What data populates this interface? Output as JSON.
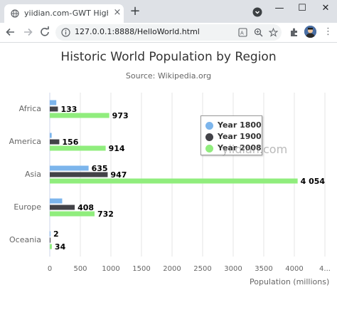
{
  "browser": {
    "tab_title": "yiidian.com-GWT Highcharts",
    "tab_close": "×",
    "new_tab": "+",
    "url": "127.0.0.1:8888/HelloWorld.html",
    "minimize": "—",
    "maximize": "☐",
    "close": "✕",
    "menu": "⋮",
    "icons": [
      "globe-icon",
      "back-icon",
      "forward-icon",
      "reload-icon",
      "info-icon",
      "translate-icon",
      "zoom-icon",
      "star-icon",
      "extensions-icon",
      "profile-avatar",
      "tab-search-icon"
    ]
  },
  "watermark": "yiidian.com",
  "chart_data": {
    "type": "bar",
    "orientation": "horizontal",
    "title": "Historic World Population by Region",
    "subtitle": "Source: Wikipedia.org",
    "xlabel": "",
    "ylabel": "Population (millions)",
    "categories": [
      "Africa",
      "America",
      "Asia",
      "Europe",
      "Oceania"
    ],
    "series": [
      {
        "name": "Year 1800",
        "color": "#7cb5ec",
        "values": [
          107,
          31,
          635,
          203,
          2
        ]
      },
      {
        "name": "Year 1900",
        "color": "#434348",
        "values": [
          133,
          156,
          947,
          408,
          6
        ]
      },
      {
        "name": "Year 2008",
        "color": "#90ed7d",
        "values": [
          973,
          914,
          4054,
          732,
          34
        ]
      }
    ],
    "data_labels": [
      [
        "",
        "133",
        "973"
      ],
      [
        "",
        "156",
        "914"
      ],
      [
        "635",
        "947",
        "4 054"
      ],
      [
        "",
        "408",
        "732"
      ],
      [
        "2",
        "",
        "34"
      ]
    ],
    "value_axis_ticks": [
      "0",
      "500",
      "1000",
      "1500",
      "2000",
      "2500",
      "3000",
      "3500",
      "4000",
      "4..."
    ],
    "xlim": [
      0,
      4500
    ],
    "grid": true,
    "legend_position": "inside-right"
  }
}
